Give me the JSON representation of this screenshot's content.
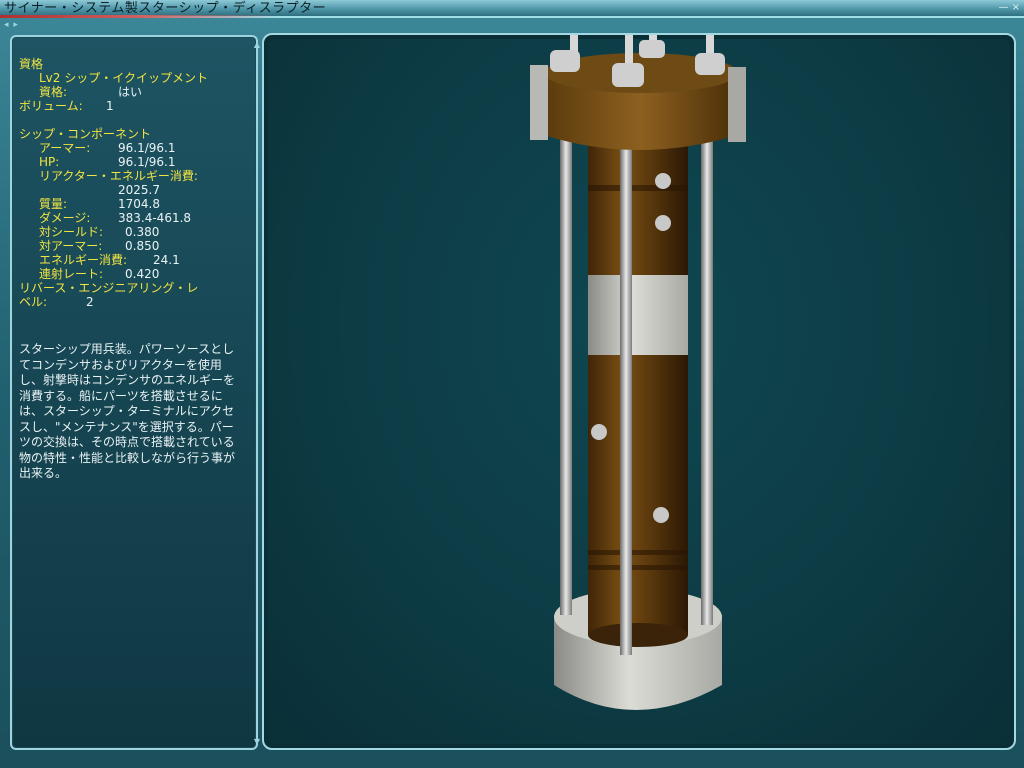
{
  "window": {
    "title": "サイナー・システム製スターシップ・ディスラプター",
    "controls_text": "— ×"
  },
  "nav": {
    "arrows": "◂ ▸"
  },
  "qualification": {
    "heading": "資格",
    "level": "Lv2 シップ・イクイップメント",
    "eligible_label": "資格:",
    "eligible_value": "はい",
    "volume_label": "ボリューム:",
    "volume_value": "1"
  },
  "ship_component": {
    "heading": "シップ・コンポーネント",
    "armor_label": "アーマー:",
    "armor_value": "96.1/96.1",
    "hp_label": "HP:",
    "hp_value": "96.1/96.1",
    "reactor_label": "リアクター・エネルギー消費:",
    "reactor_value": "2025.7",
    "mass_label": "質量:",
    "mass_value": "1704.8",
    "damage_label": "ダメージ:",
    "damage_value": "383.4-461.8",
    "vs_shield_label": "対シールド:",
    "vs_shield_value": "0.380",
    "vs_armor_label": "対アーマー:",
    "vs_armor_value": "0.850",
    "energy_label": "エネルギー消費:",
    "energy_value": "24.1",
    "refire_label": "連射レート:",
    "refire_value": "0.420"
  },
  "reverse_engineering": {
    "label_line1": "リバース・エンジニアリング・レ",
    "label_line2": "ベル:",
    "value": "2"
  },
  "description": "スターシップ用兵装。パワーソースとしてコンデンサおよびリアクターを使用し、射撃時はコンデンサのエネルギーを消費する。船にパーツを搭載させるには、スターシップ・ターミナルにアクセスし、\"メンテナンス\"を選択する。パーツの交換は、その時点で搭載されている物の特性・性能と比較しながら行う事が出来る。",
  "scroll": {
    "up": "▲",
    "down": "▼"
  },
  "colors": {
    "label_yellow": "#f1e340",
    "text_white": "#e9f3f5",
    "frame_teal": "#21606f",
    "viewport_bg": "#0d3c45"
  }
}
